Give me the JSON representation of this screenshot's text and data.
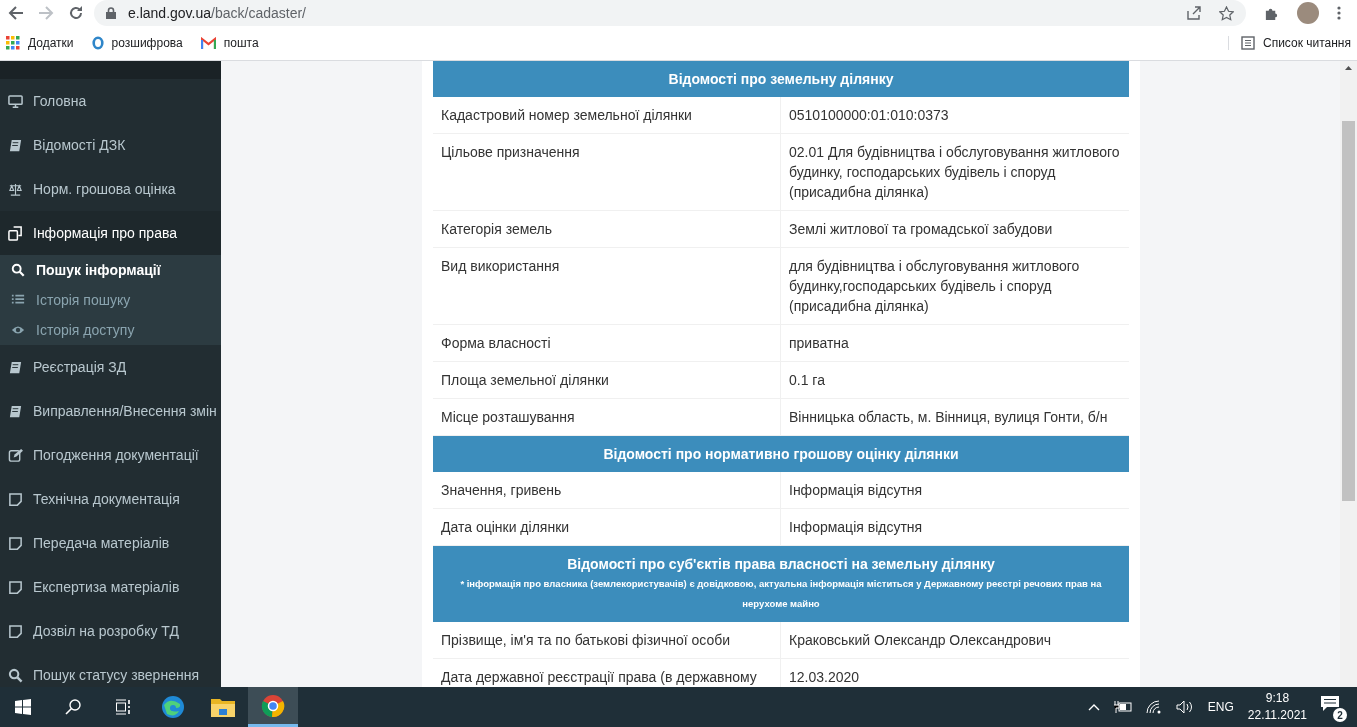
{
  "browser": {
    "address_host": "e.land.gov.ua",
    "address_path": "/back/cadaster/",
    "bookmarks": [
      {
        "kind": "apps",
        "label": "Додатки"
      },
      {
        "kind": "ring",
        "label": "розшифрова"
      },
      {
        "kind": "mail",
        "label": "пошта"
      }
    ],
    "reading_list": "Список читання"
  },
  "sidebar": {
    "items": [
      {
        "kind": "monitor",
        "label": "Головна",
        "selected": false
      },
      {
        "kind": "book",
        "label": "Відомості ДЗК",
        "selected": false
      },
      {
        "kind": "scale",
        "label": "Норм. грошова оцінка",
        "selected": false
      },
      {
        "kind": "copy",
        "label": "Інформація про права",
        "selected": true,
        "children": [
          {
            "kind": "search",
            "label": "Пошук інформації",
            "selected": true
          },
          {
            "kind": "list",
            "label": "Історія пошуку",
            "selected": false
          },
          {
            "kind": "eye",
            "label": "Історія доступу",
            "selected": false
          }
        ]
      },
      {
        "kind": "book",
        "label": "Реєстрація ЗД",
        "selected": false
      },
      {
        "kind": "book",
        "label": "Виправлення/Внесення змін",
        "selected": false
      },
      {
        "kind": "edit",
        "label": "Погодження документації",
        "selected": false
      },
      {
        "kind": "note",
        "label": "Технічна документація",
        "selected": false
      },
      {
        "kind": "note",
        "label": "Передача матеріалів",
        "selected": false
      },
      {
        "kind": "note",
        "label": "Експертиза матеріалів",
        "selected": false
      },
      {
        "kind": "note",
        "label": "Дозвіл на розробку ТД",
        "selected": false
      },
      {
        "kind": "search",
        "label": "Пошук статусу звернення",
        "selected": false
      }
    ]
  },
  "sections": [
    {
      "title": "Відомості про земельну ділянку",
      "rows": [
        {
          "label": "Кадастровий номер земельної ділянки",
          "value": "0510100000:01:010:0373"
        },
        {
          "label": "Цільове призначення",
          "value": "02.01 Для будівництва і обслуговування житлового будинку, господарських будівель і споруд (присадибна ділянка)"
        },
        {
          "label": "Категорія земель",
          "value": "Землі житлової та громадської забудови"
        },
        {
          "label": "Вид використання",
          "value": "для будівництва і обслуговування житлового будинку,господарських будівель і споруд (присадибна ділянка)"
        },
        {
          "label": "Форма власності",
          "value": "приватна"
        },
        {
          "label": "Площа земельної ділянки",
          "value": "0.1 га"
        },
        {
          "label": "Місце розташування",
          "value": "Вінницька область, м. Вінниця, вулиця Гонти, б/н"
        }
      ]
    },
    {
      "title": "Відомості про нормативно грошову оцінку ділянки",
      "rows": [
        {
          "label": "Значення, гривень",
          "value": "Інформація відсутня"
        },
        {
          "label": "Дата оцінки ділянки",
          "value": "Інформація відсутня"
        }
      ]
    },
    {
      "title": "Відомості про суб'єктів права власності на земельну ділянку",
      "note": "* інформація про власника (землекористувачів) є довідковою, актуальна інформація міститься у Державному реєстрі речових прав на нерухоме майно",
      "rows": [
        {
          "label": "Прізвище, ім'я та по батькові фізичної особи",
          "value": "Краковський Олександр Олександрович"
        },
        {
          "label": "Дата державної реєстрації права (в державному",
          "value": "12.03.2020"
        }
      ]
    }
  ],
  "taskbar": {
    "apps": [
      {
        "kind": "windows",
        "selected": false
      },
      {
        "kind": "search",
        "selected": false
      },
      {
        "kind": "taskview",
        "selected": false
      },
      {
        "kind": "edge",
        "selected": false
      },
      {
        "kind": "folder",
        "selected": false
      },
      {
        "kind": "chrome",
        "selected": true
      }
    ],
    "language": "ENG",
    "time": "9:18",
    "date": "22.11.2021",
    "notifications": "2"
  }
}
